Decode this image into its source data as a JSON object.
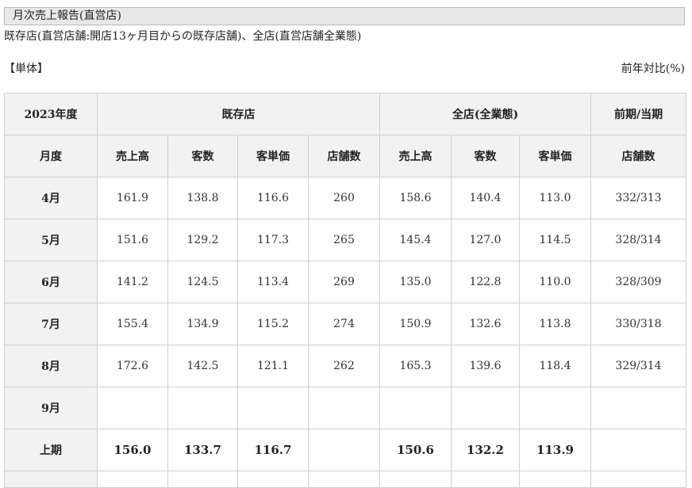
{
  "report": {
    "title": "月次売上報告(直営店)",
    "note": "既存店(直営店舗:開店13ヶ月目からの既存店舗)、全店(直営店舗全業態)",
    "unit_left": "【単体】",
    "unit_right": "前年対比(%)"
  },
  "table": {
    "year_label": "2023年度",
    "groups": {
      "existing": "既存店",
      "all": "全店(全業態)",
      "store_count_compare": "前期/当期"
    },
    "month_header": "月度",
    "columns": {
      "existing": [
        "売上高",
        "客数",
        "客単価",
        "店舗数"
      ],
      "all": [
        "売上高",
        "客数",
        "客単価"
      ],
      "stores": "店舗数"
    },
    "rows": [
      {
        "month": "4月",
        "existing": [
          "161.9",
          "138.8",
          "116.6",
          "260"
        ],
        "all": [
          "158.6",
          "140.4",
          "113.0"
        ],
        "stores": "332/313"
      },
      {
        "month": "5月",
        "existing": [
          "151.6",
          "129.2",
          "117.3",
          "265"
        ],
        "all": [
          "145.4",
          "127.0",
          "114.5"
        ],
        "stores": "328/314"
      },
      {
        "month": "6月",
        "existing": [
          "141.2",
          "124.5",
          "113.4",
          "269"
        ],
        "all": [
          "135.0",
          "122.8",
          "110.0"
        ],
        "stores": "328/309"
      },
      {
        "month": "7月",
        "existing": [
          "155.4",
          "134.9",
          "115.2",
          "274"
        ],
        "all": [
          "150.9",
          "132.6",
          "113.8"
        ],
        "stores": "330/318"
      },
      {
        "month": "8月",
        "existing": [
          "172.6",
          "142.5",
          "121.1",
          "262"
        ],
        "all": [
          "165.3",
          "139.6",
          "118.4"
        ],
        "stores": "329/314"
      },
      {
        "month": "9月",
        "existing": [
          "",
          "",
          "",
          ""
        ],
        "all": [
          "",
          "",
          ""
        ],
        "stores": ""
      }
    ],
    "total": {
      "label": "上期",
      "existing": [
        "156.0",
        "133.7",
        "116.7",
        ""
      ],
      "all": [
        "150.6",
        "132.2",
        "113.9"
      ],
      "stores": ""
    }
  }
}
